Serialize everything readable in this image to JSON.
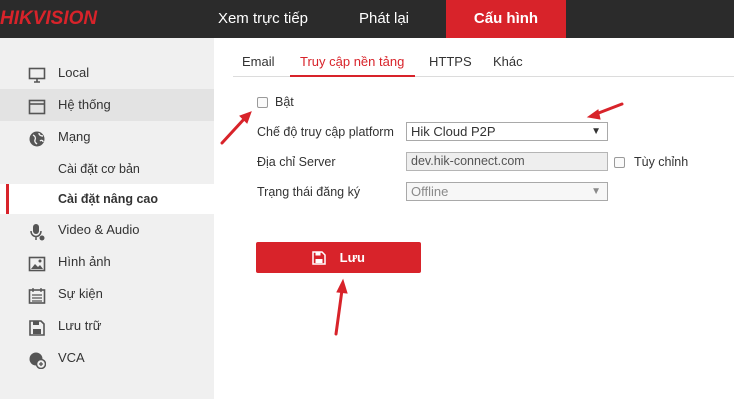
{
  "header": {
    "logo": "HIKVISION",
    "nav": {
      "live": "Xem trực tiếp",
      "playback": "Phát lại",
      "config": "Cấu hình"
    }
  },
  "sidebar": {
    "items": [
      {
        "label": "Local",
        "icon": "monitor-icon"
      },
      {
        "label": "Hệ thống",
        "icon": "window-icon"
      },
      {
        "label": "Mạng",
        "icon": "globe-icon"
      },
      {
        "label": "Cài đặt cơ bản"
      },
      {
        "label": "Cài đặt nâng cao"
      },
      {
        "label": "Video & Audio",
        "icon": "mic-icon"
      },
      {
        "label": "Hình ảnh",
        "icon": "image-icon"
      },
      {
        "label": "Sự kiện",
        "icon": "calendar-icon"
      },
      {
        "label": "Lưu trữ",
        "icon": "save-icon"
      },
      {
        "label": "VCA",
        "icon": "vca-icon"
      }
    ]
  },
  "tabs": {
    "email": "Email",
    "platform": "Truy cập nền tảng",
    "https": "HTTPS",
    "other": "Khác"
  },
  "form": {
    "enable_label": "Bật",
    "mode_label": "Chế độ truy cập platform",
    "mode_value": "Hik Cloud P2P",
    "server_label": "Địa chỉ Server",
    "server_value": "dev.hik-connect.com",
    "custom_label": "Tùy chỉnh",
    "status_label": "Trạng thái đăng ký",
    "status_value": "Offline"
  },
  "save_label": "Lưu",
  "colors": {
    "accent": "#d8232a",
    "topbar": "#2b2b2b",
    "sidebar": "#f0f0f0"
  }
}
